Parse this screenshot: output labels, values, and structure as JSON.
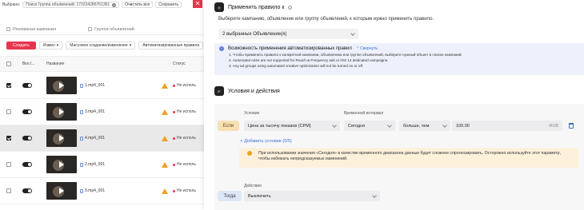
{
  "topbar": {
    "selected_label": "Выбрано:",
    "search_chip": "Поиск Группа объявлений:",
    "search_value": "1722242867613­61",
    "clear_all": "Очистить все",
    "save": "Сохранить"
  },
  "tabs": [
    "Рекламная кампания",
    "Группа объявлений"
  ],
  "toolbar": {
    "create": "Создать",
    "edit": "Измен",
    "bulk": "Массовое создание/изменение",
    "auto_rules": "Автоматизированные правила"
  },
  "table": {
    "headers": [
      "Вкл./...",
      "Название",
      "Статус"
    ],
    "rows": [
      {
        "name": "1.mp4_001",
        "status": "Не исполь",
        "checked": true,
        "selected": false
      },
      {
        "name": "3.mp4_001",
        "status": "Не исполь",
        "checked": false,
        "selected": false
      },
      {
        "name": "4.mp4_001",
        "status": "Не исполь",
        "checked": true,
        "selected": true
      },
      {
        "name": "2.mp4_001",
        "status": "Не исполь",
        "checked": false,
        "selected": false
      },
      {
        "name": "5.mp4_001",
        "status": "Не исполь",
        "checked": false,
        "selected": false
      }
    ]
  },
  "panel": {
    "apply_title": "Применить правило к",
    "apply_prompt": "Выберите кампанию, объявление или группу объявлений, к которым нужно применить правило.",
    "apply_select": "2 выбранных Объявление(я)",
    "info": {
      "title": "Возможность применения автоматизированных правил",
      "collapse": "Свернуть",
      "lines": [
        "1. Чтобы применить правило к конкретной кампании, объявлению или группе объявлений, выберите нужный объект в списке кампаний.",
        "2. Automated rules are not supported for Reach & Frequency ads or iOS 14 dedicated campaigns.",
        "3. Any ad groups using automated creative optimization will not be turned on or off."
      ]
    },
    "conditions_title": "Условия и действия",
    "cond_label": "Условие",
    "interval_label": "Временной интервал",
    "if_label": "Если",
    "metric": "Цена за тысячу показов (CPM)",
    "interval": "Сегодня",
    "operator": "больше, чем",
    "value": "100.00",
    "currency": "RUB",
    "add_condition": "Добавить условие (0/5)",
    "warning": "При использовании значения «Сегодня» в качестве временного диапазона данные будет сложнее спрогнозировать. Осторожно используйте этот параметр, чтобы избежать непредсказуемых изменений.",
    "action_label": "Действие",
    "then_label": "Тогда",
    "action_value": "Выключить"
  },
  "colors": {
    "accent": "#e8354d",
    "link": "#3b6fd8",
    "info_bg": "#eef1fb",
    "warn_bg": "#fdf1dc"
  }
}
